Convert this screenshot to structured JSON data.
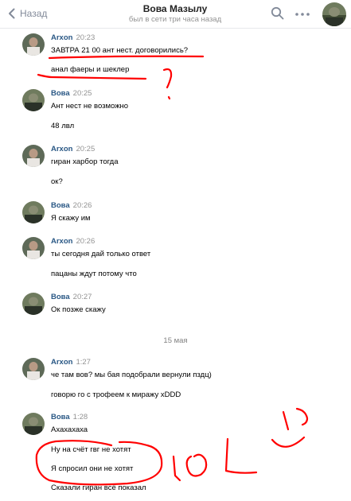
{
  "header": {
    "back_label": "Назад",
    "title": "Вова Мазылу",
    "subtitle": "был в сети три часа назад"
  },
  "messages": [
    {
      "author": "Arxon",
      "time": "20:23",
      "avatar": "arxon-avatar",
      "lines": [
        "ЗАВТРА 21 00 ант нест. договорились?",
        "анал фаеры и шеклер"
      ]
    },
    {
      "author": "Вова",
      "time": "20:25",
      "avatar": "vova-avatar",
      "lines": [
        "Ант нест не возможно",
        "48 лвл"
      ]
    },
    {
      "author": "Arxon",
      "time": "20:25",
      "avatar": "arxon-avatar",
      "lines": [
        "гиран харбор тогда",
        "ок?"
      ]
    },
    {
      "author": "Вова",
      "time": "20:26",
      "avatar": "vova-avatar",
      "lines": [
        "Я скажу им"
      ]
    },
    {
      "author": "Arxon",
      "time": "20:26",
      "avatar": "arxon-avatar",
      "lines": [
        "ты сегодня дай только ответ",
        "пацаны ждут потому что"
      ]
    },
    {
      "author": "Вова",
      "time": "20:27",
      "avatar": "vova-avatar",
      "lines": [
        "Ок позже скажу"
      ]
    },
    {
      "author": "Arxon",
      "time": "1:27",
      "avatar": "arxon-avatar",
      "lines": [
        "че там вов? мы бая подобрали вернули пздц)",
        "говорю го с трофеем к миражу xDDD"
      ]
    },
    {
      "author": "Вова",
      "time": "1:28",
      "avatar": "vova-avatar",
      "lines": [
        "Ахахахаха",
        "Ну на счёт гвг не хотят",
        "Я спросил они не хотят",
        "Сказали гиран всё показал"
      ]
    }
  ],
  "date_separator": "15 мая",
  "colors": {
    "author": "#2a5885",
    "meta_gray": "#939393",
    "doodle_red": "#ff0000"
  }
}
